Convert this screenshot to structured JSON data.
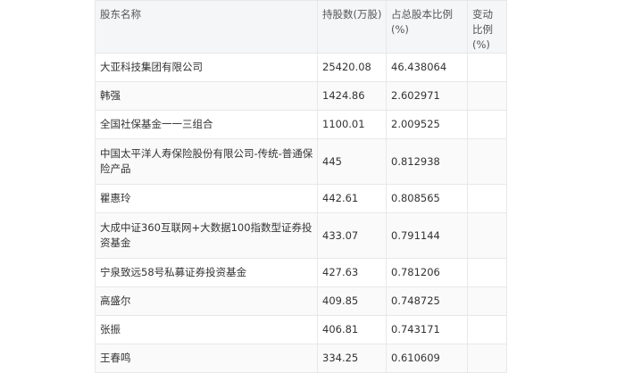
{
  "table": {
    "headers": {
      "name": "股东名称",
      "shares": "持股数(万股)",
      "ratio": "占总股本比例(%)",
      "change": "变动比例(%)"
    },
    "rows": [
      {
        "name": "大亚科技集团有限公司",
        "shares": "25420.08",
        "ratio": "46.438064",
        "change": ""
      },
      {
        "name": "韩强",
        "shares": "1424.86",
        "ratio": "2.602971",
        "change": ""
      },
      {
        "name": "全国社保基金一一三组合",
        "shares": "1100.01",
        "ratio": "2.009525",
        "change": ""
      },
      {
        "name": "中国太平洋人寿保险股份有限公司-传统-普通保险产品",
        "shares": "445",
        "ratio": "0.812938",
        "change": ""
      },
      {
        "name": "瞿惠玲",
        "shares": "442.61",
        "ratio": "0.808565",
        "change": ""
      },
      {
        "name": "大成中证360互联网+大数据100指数型证券投资基金",
        "shares": "433.07",
        "ratio": "0.791144",
        "change": ""
      },
      {
        "name": "宁泉致远58号私募证券投资基金",
        "shares": "427.63",
        "ratio": "0.781206",
        "change": ""
      },
      {
        "name": "高盛尔",
        "shares": "409.85",
        "ratio": "0.748725",
        "change": ""
      },
      {
        "name": "张振",
        "shares": "406.81",
        "ratio": "0.743171",
        "change": ""
      },
      {
        "name": "王春鸣",
        "shares": "334.25",
        "ratio": "0.610609",
        "change": ""
      }
    ]
  }
}
